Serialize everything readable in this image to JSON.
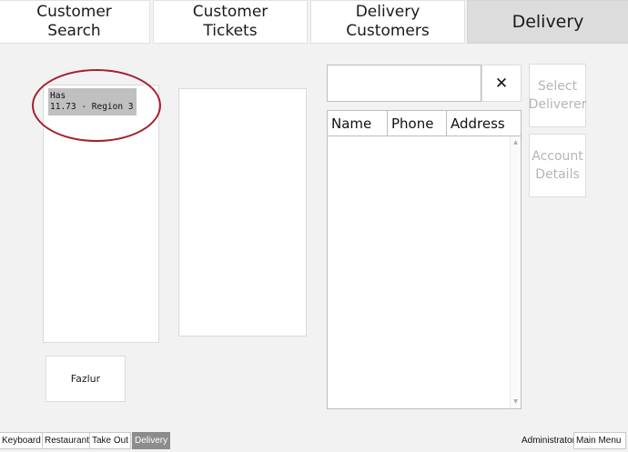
{
  "tabs": [
    {
      "label": "Customer\nSearch"
    },
    {
      "label": "Customer\nTickets"
    },
    {
      "label": "Delivery\nCustomers"
    },
    {
      "label": "Delivery"
    }
  ],
  "ticket": {
    "line1": "Has",
    "line2": "11.73 - Region 3"
  },
  "annotation_color": "#a61f2a",
  "deliverer_button": "Fazlur",
  "search": {
    "value": "",
    "placeholder": "",
    "clear_label": "✕"
  },
  "grid": {
    "columns": [
      "Name",
      "Phone",
      "Address"
    ],
    "rows": []
  },
  "side_buttons": {
    "select_deliverer": "Select\nDeliverer",
    "account_details": "Account\nDetails"
  },
  "bottom_bar": {
    "buttons": [
      "Keyboard",
      "Restaurant",
      "Take Out",
      "Delivery"
    ],
    "user": "Administrator",
    "main_menu": "Main Menu"
  }
}
